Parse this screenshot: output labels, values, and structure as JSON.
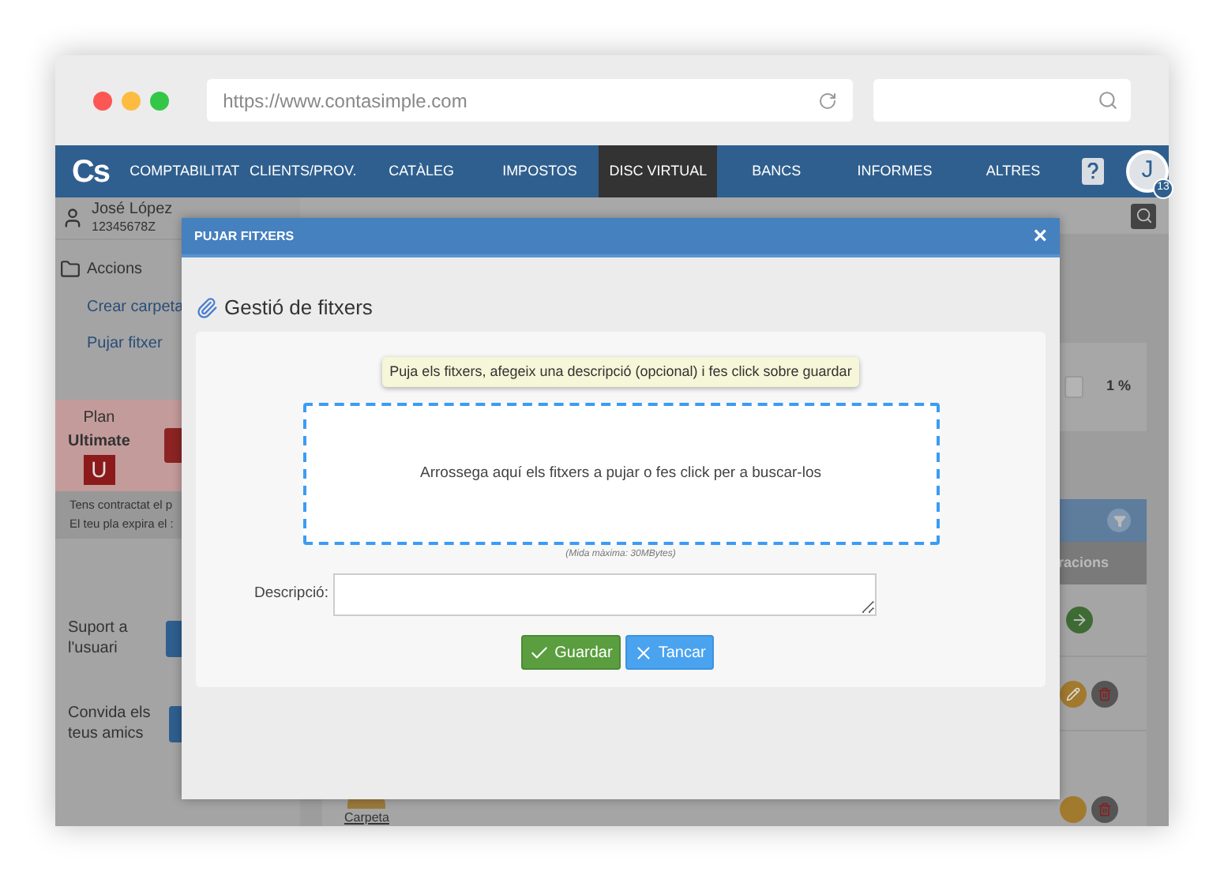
{
  "browser": {
    "url": "https://www.contasimple.com"
  },
  "nav": {
    "logo": "Cs",
    "items": [
      {
        "label": "COMPTABILITAT",
        "selected": false
      },
      {
        "label": "CLIENTS/PROV.",
        "selected": false
      },
      {
        "label": "CATÀLEG",
        "selected": false
      },
      {
        "label": "IMPOSTOS",
        "selected": false
      },
      {
        "label": "DISC VIRTUAL",
        "selected": true
      },
      {
        "label": "BANCS",
        "selected": false
      },
      {
        "label": "INFORMES",
        "selected": false
      },
      {
        "label": "ALTRES",
        "selected": false
      }
    ],
    "avatar": "J",
    "badge": "13"
  },
  "sidebar": {
    "user_name": "José López",
    "user_id": "12345678Z",
    "actions_title": "Accions",
    "actions": [
      "Crear carpeta",
      "Pujar fitxer"
    ],
    "plan_label": "Plan",
    "plan_name": "Ultimate",
    "plan_badge": "U",
    "notes": [
      "Tens contractat el p",
      "El teu pla expira el :"
    ],
    "support": "Suport a l'usuari",
    "invite": "Convida els teus amics"
  },
  "main": {
    "percent": "1 %",
    "column_header": "racions",
    "folder_label": "Carpeta"
  },
  "modal": {
    "title": "PUJAR FITXERS",
    "close": "×",
    "heading": "Gestió de fitxers",
    "hint": "Puja els fitxers, afegeix una descripció (opcional) i fes click sobre guardar",
    "dropzone": "Arrossega aquí els fitxers a pujar o fes click per a buscar-los",
    "size_note": "(Mida màxima: 30MBytes)",
    "description_label": "Descripció:",
    "buttons": [
      {
        "label": "Guardar",
        "kind": "save"
      },
      {
        "label": "Tancar",
        "kind": "cancel"
      }
    ]
  }
}
